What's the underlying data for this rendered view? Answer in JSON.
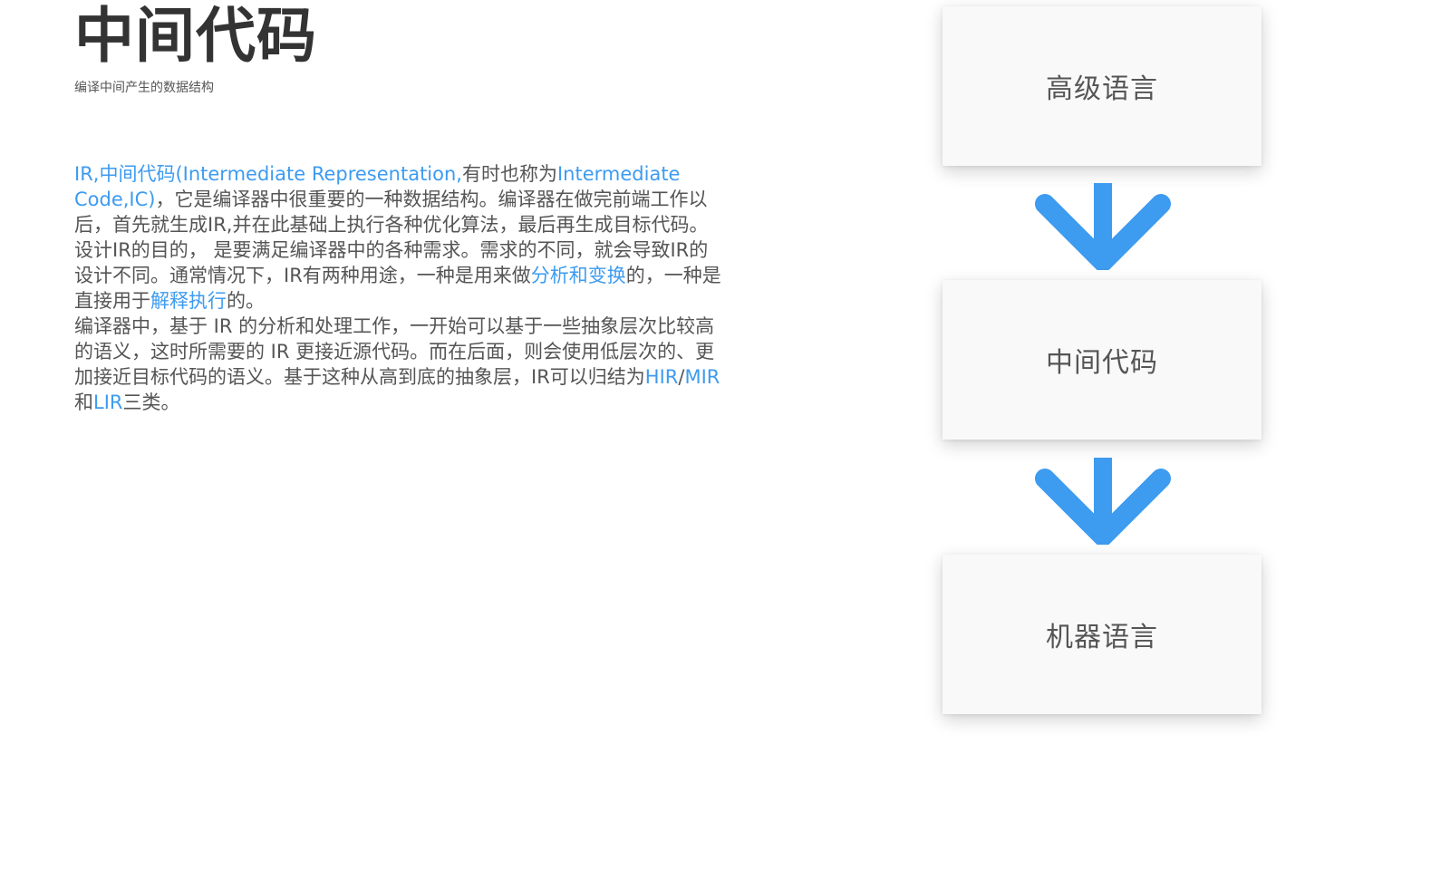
{
  "header": {
    "title": "中间代码",
    "subtitle": "编译中间产生的数据结构"
  },
  "body": {
    "p1_hl": "IR,中间代码(Intermediate Representation,",
    "p1_a": "有时也称为",
    "p1_hl2": "Intermediate Code,IC)",
    "p1_b": "，它是编译器中很重要的一种数据结构。编译器在做完前端工作以后，首先就生成IR,并在此基础上执行各种优化算法，最后再生成目标代码。",
    "p2_a": "设计IR的目的， 是要满足编译器中的各种需求。需求的不同，就会导致IR的设计不同。通常情况下，IR有两种用途，一种是用来做",
    "p2_hl1": "分析和变换",
    "p2_b": "的，一种是直接用于",
    "p2_hl2": "解释执行",
    "p2_c": "的。",
    "p3_a": "编译器中，基于 IR 的分析和处理工作，一开始可以基于一些抽象层次比较高的语义，这时所需要的 IR 更接近源代码。而在后面，则会使用低层次的、更加接近目标代码的语义。基于这种从高到底的抽象层，IR可以归结为",
    "p3_hl1": "HIR",
    "p3_sep": "/",
    "p3_hl2": "MIR",
    "p3_and": "和",
    "p3_hl3": "LIR",
    "p3_end": "三类。"
  },
  "flow": {
    "steps": [
      "高级语言",
      "中间代码",
      "机器语言"
    ],
    "arrow_color": "#3d9bf0",
    "box_color": "#f9f9f9"
  },
  "colors": {
    "accent": "#3d9bf0",
    "text": "#555555",
    "title": "#333333"
  }
}
